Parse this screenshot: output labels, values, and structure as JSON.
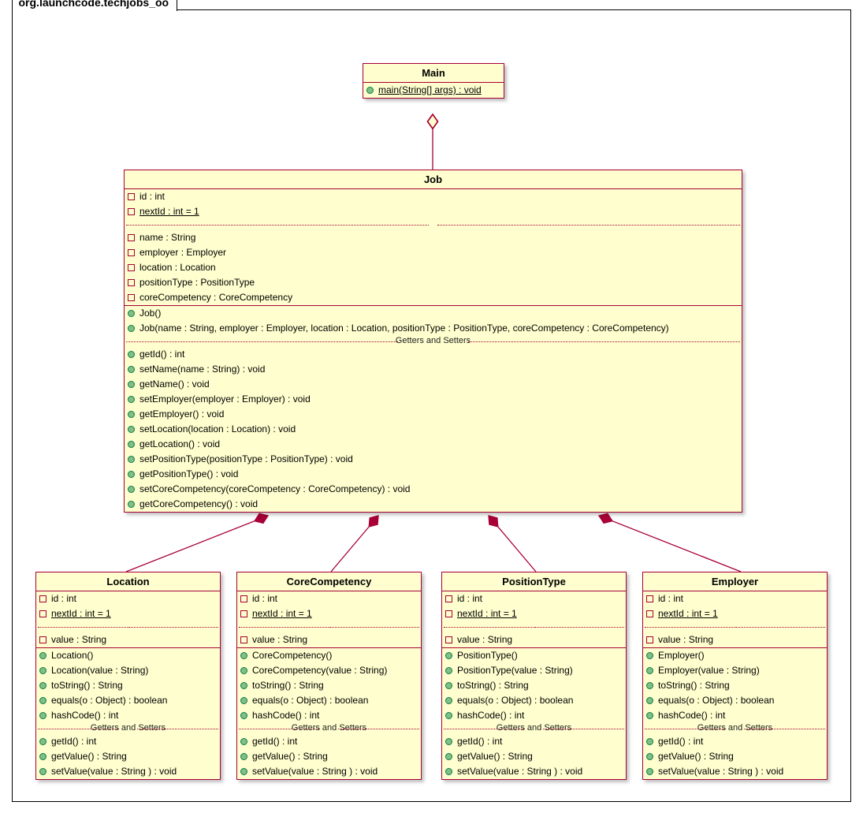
{
  "package_name": "org.launchcode.techjobs_oo",
  "separator_label": "Getters and Setters",
  "classes": {
    "main": {
      "name": "Main",
      "methods": [
        "main(String[] args) : void"
      ]
    },
    "job": {
      "name": "Job",
      "fields1": [
        "id : int",
        "nextId : int = 1"
      ],
      "fields2": [
        "name : String",
        "employer : Employer",
        "location : Location",
        "positionType : PositionType",
        "coreCompetency : CoreCompetency"
      ],
      "constructors": [
        "Job()",
        "Job(name : String, employer : Employer, location : Location, positionType : PositionType, coreCompetency : CoreCompetency)"
      ],
      "accessors": [
        "getId() : int",
        "setName(name : String) : void",
        "getName() : void",
        "setEmployer(employer : Employer) : void",
        "getEmployer() : void",
        "setLocation(location : Location) : void",
        "getLocation() : void",
        "setPositionType(positionType : PositionType) : void",
        "getPositionType() : void",
        "setCoreCompetency(coreCompetency : CoreCompetency) : void",
        "getCoreCompetency() : void"
      ]
    },
    "location": {
      "name": "Location",
      "fields1": [
        "id : int",
        "nextId : int = 1"
      ],
      "fields2": [
        "value : String"
      ],
      "methods": [
        "Location()",
        "Location(value : String)",
        "toString() : String",
        "equals(o : Object) : boolean",
        "hashCode() : int"
      ],
      "accessors": [
        "getId() : int",
        "getValue() : String",
        "setValue(value : String ) : void"
      ]
    },
    "corecompetency": {
      "name": "CoreCompetency",
      "fields1": [
        "id : int",
        "nextId : int = 1"
      ],
      "fields2": [
        "value : String"
      ],
      "methods": [
        "CoreCompetency()",
        "CoreCompetency(value : String)",
        "toString() : String",
        "equals(o : Object) : boolean",
        "hashCode() : int"
      ],
      "accessors": [
        "getId() : int",
        "getValue() : String",
        "setValue(value : String ) : void"
      ]
    },
    "positiontype": {
      "name": "PositionType",
      "fields1": [
        "id : int",
        "nextId : int = 1"
      ],
      "fields2": [
        "value : String"
      ],
      "methods": [
        "PositionType()",
        "PositionType(value : String)",
        "toString() : String",
        "equals(o : Object) : boolean",
        "hashCode() : int"
      ],
      "accessors": [
        "getId() : int",
        "getValue() : String",
        "setValue(value : String ) : void"
      ]
    },
    "employer": {
      "name": "Employer",
      "fields1": [
        "id : int",
        "nextId : int = 1"
      ],
      "fields2": [
        "value : String"
      ],
      "methods": [
        "Employer()",
        "Employer(value : String)",
        "toString() : String",
        "equals(o : Object) : boolean",
        "hashCode() : int"
      ],
      "accessors": [
        "getId() : int",
        "getValue() : String",
        "setValue(value : String ) : void"
      ]
    }
  }
}
